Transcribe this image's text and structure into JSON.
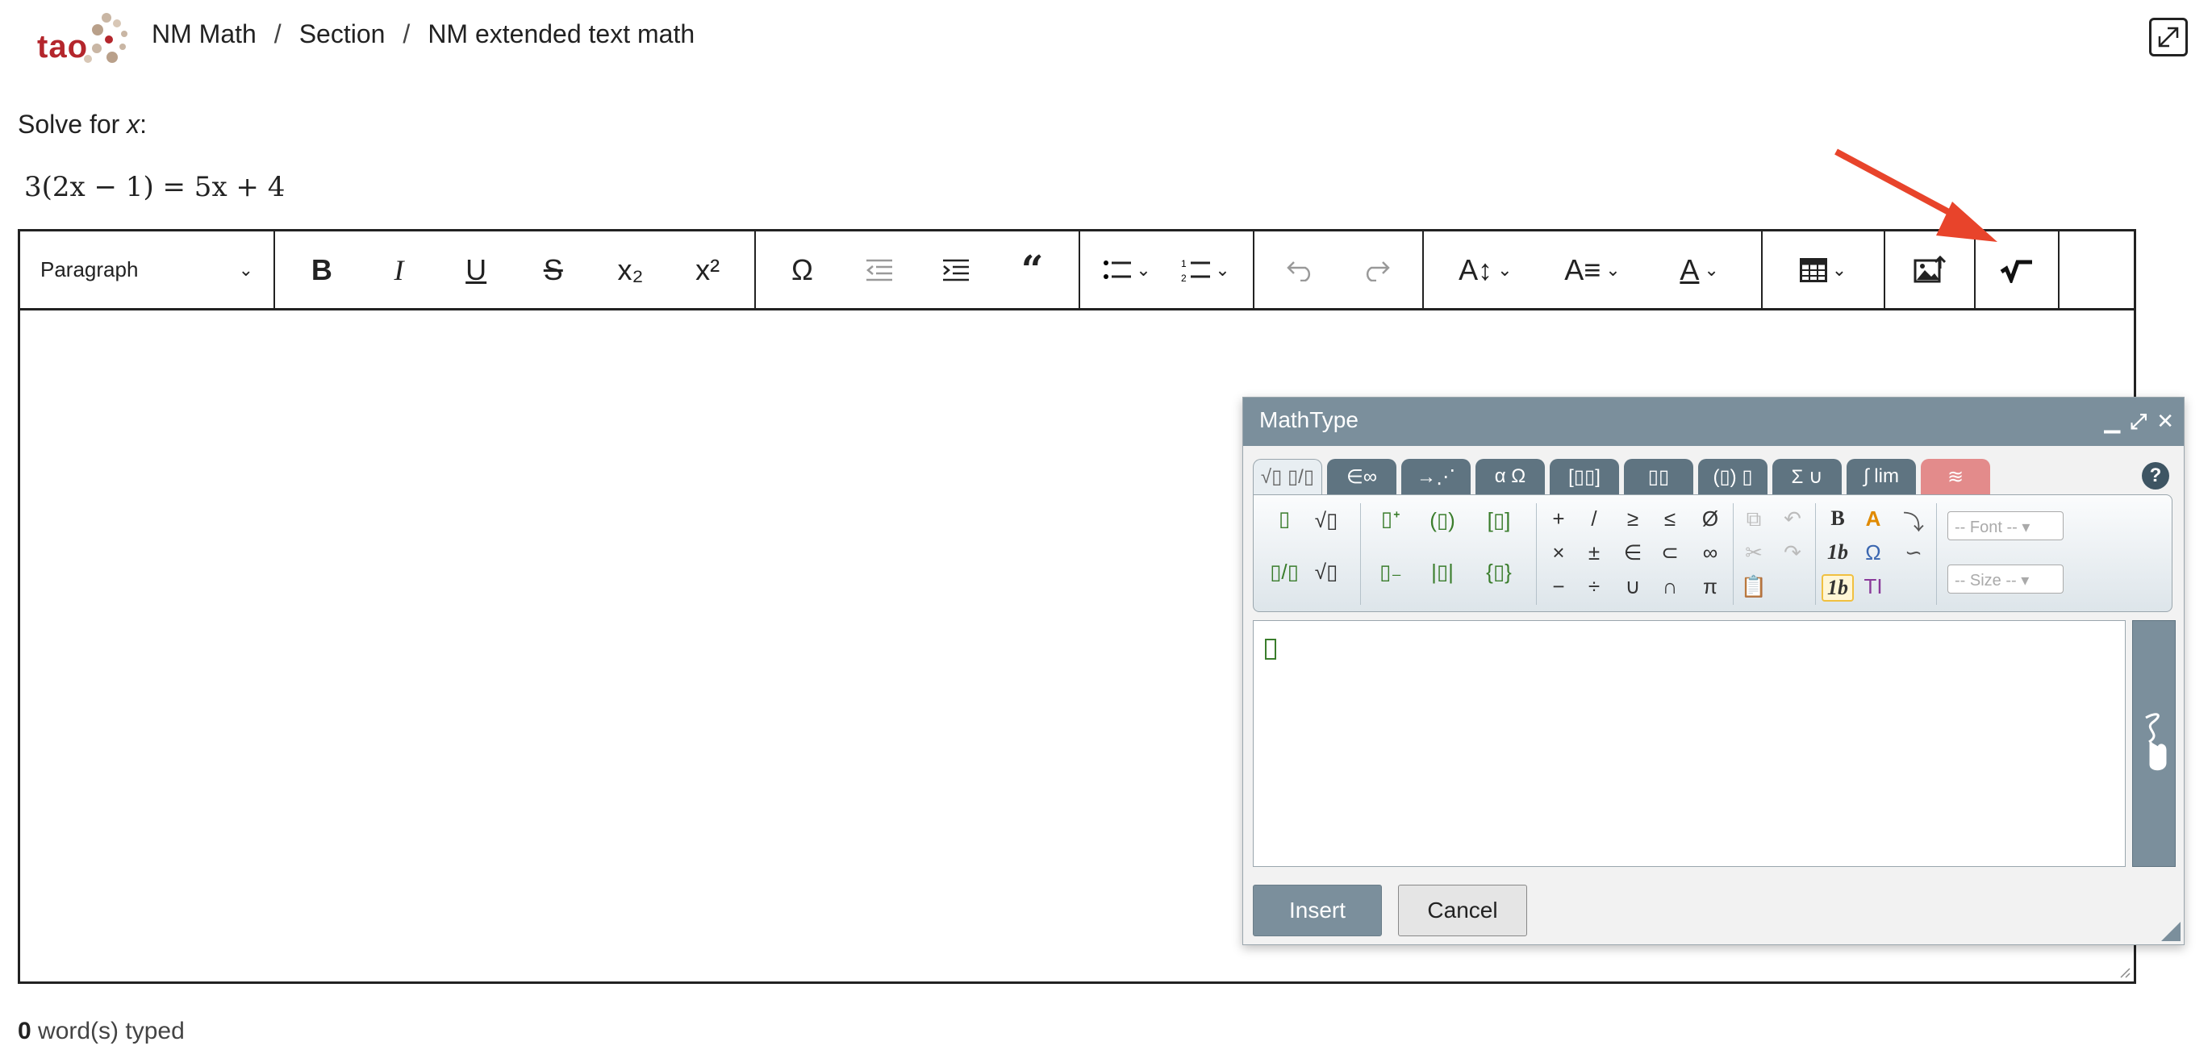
{
  "logo": {
    "text": "tao"
  },
  "breadcrumb": [
    "NM Math",
    "Section",
    "NM extended text math"
  ],
  "question": {
    "prompt_prefix": "Solve for ",
    "prompt_var": "x",
    "prompt_suffix": ":",
    "equation": "3(2x − 1) = 5x + 4"
  },
  "toolbar": {
    "paragraph": "Paragraph",
    "icons": [
      "bold-icon",
      "italic-icon",
      "underline-icon",
      "strikethrough-icon",
      "subscript-icon",
      "superscript-icon",
      "special-char-icon",
      "outdent-icon",
      "indent-icon",
      "blockquote-icon",
      "bulleted-list-icon",
      "numbered-list-icon",
      "undo-icon",
      "redo-icon",
      "font-size-icon",
      "font-family-icon",
      "font-color-icon",
      "table-icon",
      "insert-image-icon",
      "mathtype-icon"
    ],
    "bold": "B",
    "italic": "I",
    "underline": "U",
    "strike": "S",
    "subscript": "x₂",
    "superscript": "x²",
    "omega": "Ω"
  },
  "mathtype": {
    "title": "MathType",
    "help": "?",
    "tabs": [
      "√▯ ▯/▯",
      "∈∞",
      "→⋰",
      "α Ω",
      "[▯▯]",
      "▯▯",
      "(▯) ▯",
      "Σ ∪",
      "∫ lim",
      "≋"
    ],
    "symbols": {
      "plus": "+",
      "slash": "/",
      "geq": "≥",
      "leq": "≤",
      "empty": "Ø",
      "times": "×",
      "pm": "±",
      "in": "∈",
      "subset": "⊂",
      "infty": "∞",
      "minus": "−",
      "div": "÷",
      "cup": "∪",
      "cap": "∩",
      "pi": "π"
    },
    "font_select": "-- Font --",
    "size_select": "-- Size --",
    "insert_label": "Insert",
    "cancel_label": "Cancel"
  },
  "wordcount": {
    "count": "0",
    "label": " word(s) typed"
  },
  "colors": {
    "accent": "#7b8f9c",
    "brand": "#b4262c",
    "arrow": "#e8442b"
  }
}
